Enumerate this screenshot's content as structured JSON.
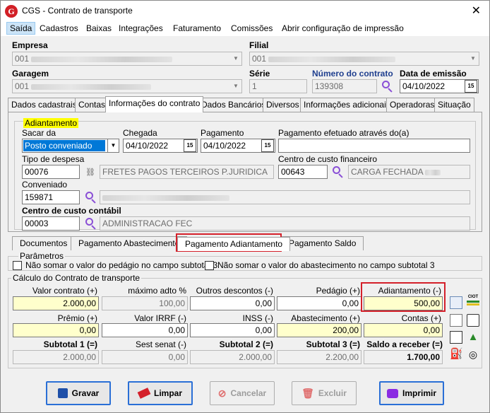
{
  "window": {
    "title": "CGS - Contrato de transporte",
    "logo": "G"
  },
  "menu": [
    "Saída",
    "Cadastros",
    "Baixas",
    "Integrações",
    "Faturamento",
    "Comissões",
    "Abrir configuração de impressão"
  ],
  "header": {
    "empresa_label": "Empresa",
    "empresa_value": "001",
    "filial_label": "Filial",
    "filial_value": "001",
    "garagem_label": "Garagem",
    "garagem_value": "001",
    "serie_label": "Série",
    "serie_value": "1",
    "numero_label": "Número do contrato",
    "numero_value": "139308",
    "data_label": "Data de emissão",
    "data_value": "04/10/2022"
  },
  "tabs": [
    "Dados cadastrais",
    "Contas",
    "Informações do contrato",
    "Dados Bancários",
    "Diversos",
    "Informações adicionais",
    "Operadoras",
    "Situação"
  ],
  "adiantamento": {
    "title": "Adiantamento",
    "sacar_label": "Sacar da",
    "sacar_value": "Posto conveniado",
    "chegada_label": "Chegada",
    "chegada_value": "04/10/2022",
    "pagamento_label": "Pagamento",
    "pagamento_value": "04/10/2022",
    "efetuado_label": "Pagamento efetuado através do(a)",
    "efetuado_value": "",
    "despesa_label": "Tipo de despesa",
    "despesa_code": "00076",
    "despesa_desc": "FRETES PAGOS TERCEIROS P.JURIDICA",
    "centro_fin_label": "Centro de custo financeiro",
    "centro_fin_code": "00643",
    "centro_fin_desc": "CARGA FECHADA",
    "conveniado_label": "Conveniado",
    "conveniado_code": "159871",
    "centro_cont_label": "Centro de custo contábil",
    "centro_cont_code": "00003",
    "centro_cont_desc": "ADMINISTRACAO FEC"
  },
  "subtabs": [
    "Documentos",
    "Pagamento Abastecimento",
    "Pagamento Adiantamento",
    "Pagamento Saldo"
  ],
  "parametros": {
    "title": "Parâmetros",
    "opt1": "Não somar o valor do pedágio no campo subtotal 3",
    "opt2": "Não somar o valor do abastecimento no campo subtotal 3"
  },
  "calculo": {
    "title": "Cálculo do Contrato de transporte",
    "row1": [
      {
        "label": "Valor contrato (+)",
        "value": "2.000,00"
      },
      {
        "label": "máximo adto %",
        "value": "100,00"
      },
      {
        "label": "Outros descontos (-)",
        "value": "0,00"
      },
      {
        "label": "Pedágio (+)",
        "value": "0,00"
      },
      {
        "label": "Adiantamento (-)",
        "value": "500,00"
      }
    ],
    "row2": [
      {
        "label": "Prêmio (+)",
        "value": "0,00"
      },
      {
        "label": "Valor IRRF (-)",
        "value": "0,00"
      },
      {
        "label": "INSS (-)",
        "value": "0,00"
      },
      {
        "label": "Abastecimento (+)",
        "value": "200,00"
      },
      {
        "label": "Contas (+)",
        "value": "0,00"
      }
    ],
    "row3": [
      {
        "label": "Subtotal 1 (=)",
        "value": "2.000,00"
      },
      {
        "label": "Sest senat (-)",
        "value": "0,00"
      },
      {
        "label": "Subtotal 2 (=)",
        "value": "2.000,00"
      },
      {
        "label": "Subtotal 3 (=)",
        "value": "2.200,00"
      },
      {
        "label": "Saldo a receber (=)",
        "value": "1.700,00"
      }
    ]
  },
  "buttons": {
    "gravar": "Gravar",
    "limpar": "Limpar",
    "cancelar": "Cancelar",
    "excluir": "Excluir",
    "imprimir": "Imprimir"
  },
  "colors": {
    "highlight": "#d4202a",
    "yellow_field": "#ffffcc",
    "tag_yellow": "#ffff00",
    "accent": "#2a6fd6"
  }
}
